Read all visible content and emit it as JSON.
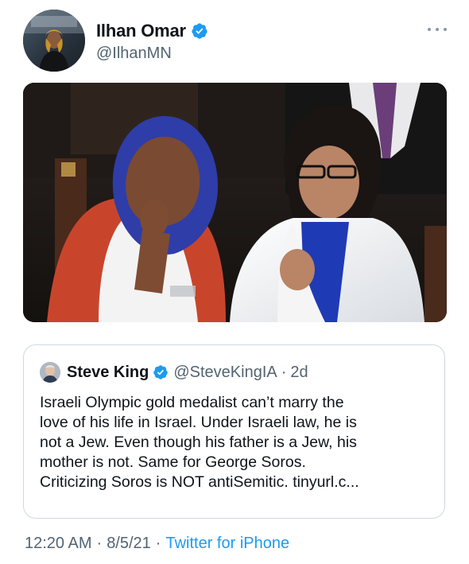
{
  "author": {
    "name": "Ilhan Omar",
    "handle": "@IlhanMN",
    "verified": true
  },
  "menu": {
    "icon": "more-horizontal-icon"
  },
  "media": {
    "description_icon": "photo"
  },
  "quoted_tweet": {
    "name": "Steve King",
    "handle": "@SteveKingIA",
    "separator": "·",
    "time": "2d",
    "verified": true,
    "text_lines": [
      "Israeli Olympic gold medalist can’t marry the",
      "love of his life in Israel. Under Israeli law, he is",
      "not a Jew. Even though his father is a Jew, his",
      "mother is not. Same for George Soros.",
      "Criticizing Soros is NOT antiSemitic.  tinyurl.c..."
    ]
  },
  "footer": {
    "time": "12:20 AM",
    "sep1": "·",
    "date": "8/5/21",
    "sep2": "·",
    "source": "Twitter for iPhone"
  },
  "colors": {
    "verified_blue": "#1d9bf0",
    "secondary_text": "#536471",
    "border": "#cfd9de"
  }
}
